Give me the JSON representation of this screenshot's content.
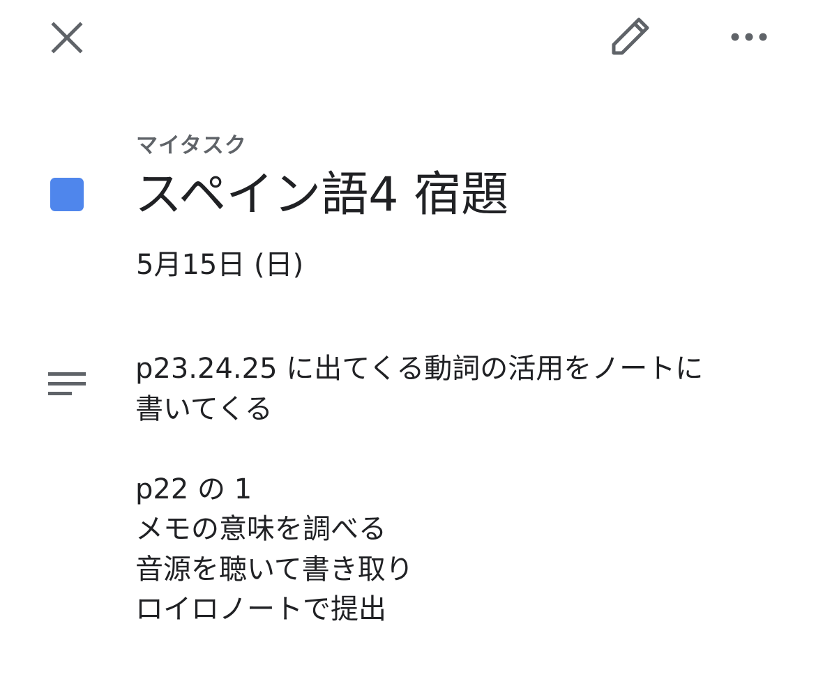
{
  "toolbar": {
    "close_icon": "close-icon",
    "edit_icon": "pencil-icon",
    "more_icon": "more-horizontal-icon"
  },
  "task": {
    "list_name": "マイタスク",
    "title": "スペイン語4 宿題",
    "due_date": "5月15日 (日)",
    "color": "#4f86ec",
    "notes_icon": "notes-icon",
    "notes_lines": [
      "p23.24.25 に出てくる動詞の活用をノートに",
      "書いてくる",
      "",
      "p22 の 1",
      "メモの意味を調べる",
      "音源を聴いて書き取り",
      "ロイロノートで提出"
    ]
  }
}
